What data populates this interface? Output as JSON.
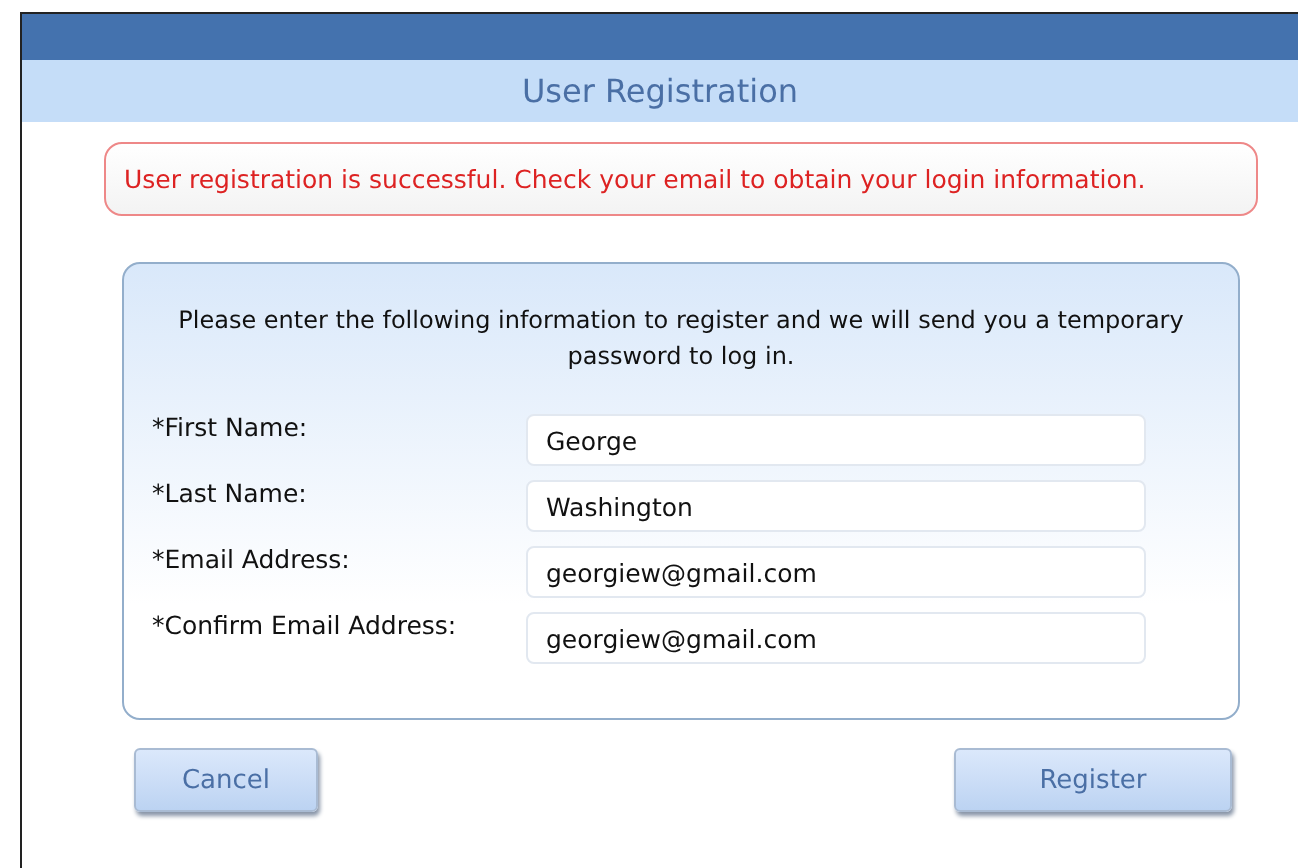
{
  "window": {
    "title": "User Registration"
  },
  "alert": {
    "message": "User registration is successful. Check your email to obtain your login information."
  },
  "form": {
    "instructions": "Please enter the following information to register and we will send you a temporary password to log in.",
    "fields": [
      {
        "label": "*First Name:",
        "value": "George"
      },
      {
        "label": "*Last Name:",
        "value": "Washington"
      },
      {
        "label": "*Email Address:",
        "value": "georgiew@gmail.com"
      },
      {
        "label": "*Confirm Email Address:",
        "value": "georgiew@gmail.com"
      }
    ]
  },
  "buttons": [
    {
      "label": "Cancel",
      "kind": "secondary"
    },
    {
      "label": "Register",
      "kind": "primary"
    }
  ]
}
